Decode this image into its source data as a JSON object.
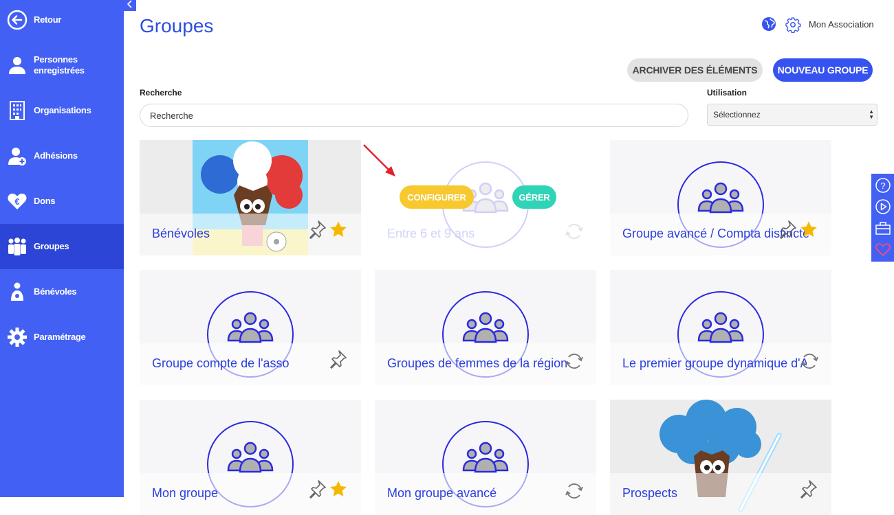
{
  "sidebar": {
    "items": [
      {
        "label": "Retour",
        "icon": "arrow-left-circle-icon"
      },
      {
        "label": "Personnes enregistrées",
        "icon": "person-icon"
      },
      {
        "label": "Organisations",
        "icon": "building-icon"
      },
      {
        "label": "Adhésions",
        "icon": "person-add-icon"
      },
      {
        "label": "Dons",
        "icon": "heart-euro-icon"
      },
      {
        "label": "Groupes",
        "icon": "group-icon",
        "active": true
      },
      {
        "label": "Bénévoles",
        "icon": "volunteer-icon"
      },
      {
        "label": "Paramétrage",
        "icon": "gear-icon"
      }
    ]
  },
  "header": {
    "title": "Groupes",
    "org_name": "Mon Association"
  },
  "toolbar": {
    "archive_label": "ARCHIVER DES ÉLÉMENTS",
    "new_group_label": "NOUVEAU GROUPE"
  },
  "filters": {
    "search_label": "Recherche",
    "search_placeholder": "Recherche",
    "usage_label": "Utilisation",
    "usage_value": "Sélectionnez"
  },
  "hover_actions": {
    "configure_label": "CONFIGURER",
    "manage_label": "GÉRER"
  },
  "groups": [
    {
      "title": "Bénévoles",
      "pinned": true,
      "starred": true,
      "image": "tree-mascot-french-flag"
    },
    {
      "title": "Entre 6 et 9 ans",
      "dynamic": true,
      "hovered": true
    },
    {
      "title": "Groupe avancé / Compta distincte",
      "pinned": true,
      "starred": true
    },
    {
      "title": "Groupe compte de l'asso",
      "pinned": true
    },
    {
      "title": "Groupes de femmes de la région ...",
      "dynamic": true
    },
    {
      "title": "Le premier groupe dynamique d'A...",
      "dynamic": true
    },
    {
      "title": "Mon groupe",
      "pinned": true,
      "starred": true
    },
    {
      "title": "Mon groupe avancé",
      "dynamic": true
    },
    {
      "title": "Prospects",
      "pinned": true,
      "image": "tree-mascot-lightsaber"
    }
  ],
  "colors": {
    "sidebar": "#4360f4",
    "accent": "#3652f0",
    "configure": "#f7c92f",
    "manage": "#2fd3b5",
    "star": "#f5b800"
  }
}
